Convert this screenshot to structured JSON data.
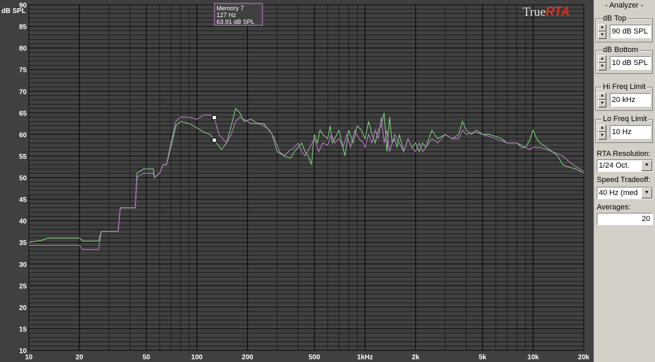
{
  "plot": {
    "y_unit_label": "dB SPL",
    "brand_true": "True",
    "brand_rta": "RTA",
    "cursor": {
      "name": "Memory 7",
      "freq": "127 Hz",
      "level": "63.91 dB SPL"
    },
    "colors": {
      "background": "#404040",
      "grid": "#0d0d0d",
      "series_green": "#7dde7d",
      "series_magenta": "#c77fd6"
    }
  },
  "panel": {
    "title": "- Analyzer -",
    "db_top": {
      "label": "dB Top",
      "value": "90 dB SPL"
    },
    "db_bottom": {
      "label": "dB Bottom",
      "value": "10 dB SPL"
    },
    "hi_freq": {
      "label": "Hi Freq Limit",
      "value": "20 kHz"
    },
    "lo_freq": {
      "label": "Lo Freq Limit",
      "value": "10 Hz"
    },
    "rta_resolution": {
      "label": "RTA Resolution:",
      "value": "1/24 Oct."
    },
    "speed_tradeoff": {
      "label": "Speed Tradeoff:",
      "value": "40 Hz (med"
    },
    "averages": {
      "label": "Averages:",
      "value": "20"
    }
  },
  "chart_data": {
    "type": "line",
    "xscale": "log",
    "xlim": [
      10,
      20000
    ],
    "ylim": [
      10,
      90
    ],
    "ylabel": "dB SPL",
    "xticks": [
      {
        "v": 10,
        "t": "10"
      },
      {
        "v": 20,
        "t": "20"
      },
      {
        "v": 50,
        "t": "50"
      },
      {
        "v": 100,
        "t": "100"
      },
      {
        "v": 200,
        "t": "200"
      },
      {
        "v": 500,
        "t": "500"
      },
      {
        "v": 1000,
        "t": "1kHz"
      },
      {
        "v": 2000,
        "t": "2k"
      },
      {
        "v": 5000,
        "t": "5k"
      },
      {
        "v": 10000,
        "t": "10k"
      },
      {
        "v": 20000,
        "t": "20k"
      }
    ],
    "yticks": [
      10,
      15,
      20,
      25,
      30,
      35,
      40,
      45,
      50,
      55,
      60,
      65,
      70,
      75,
      80,
      85,
      90
    ],
    "series": [
      {
        "color": "#7dde7d",
        "points": [
          [
            10,
            35
          ],
          [
            12,
            35.5
          ],
          [
            13,
            36
          ],
          [
            20,
            36
          ],
          [
            21,
            35.3
          ],
          [
            26,
            35.3
          ],
          [
            27,
            37.5
          ],
          [
            34,
            37.5
          ],
          [
            35,
            43
          ],
          [
            43,
            43
          ],
          [
            44,
            51
          ],
          [
            48,
            52
          ],
          [
            55,
            52
          ],
          [
            56,
            50
          ],
          [
            60,
            51
          ],
          [
            63,
            53
          ],
          [
            66,
            53
          ],
          [
            70,
            57
          ],
          [
            75,
            62
          ],
          [
            80,
            63
          ],
          [
            90,
            62.5
          ],
          [
            100,
            61.5
          ],
          [
            110,
            60.5
          ],
          [
            120,
            60
          ],
          [
            125,
            59
          ],
          [
            140,
            56.5
          ],
          [
            150,
            58
          ],
          [
            160,
            62
          ],
          [
            170,
            66
          ],
          [
            180,
            65
          ],
          [
            190,
            63
          ],
          [
            210,
            63.5
          ],
          [
            230,
            62.5
          ],
          [
            250,
            62.5
          ],
          [
            280,
            60
          ],
          [
            300,
            56
          ],
          [
            330,
            55
          ],
          [
            360,
            54.5
          ],
          [
            380,
            56
          ],
          [
            400,
            57
          ],
          [
            420,
            58
          ],
          [
            440,
            56
          ],
          [
            460,
            55
          ],
          [
            480,
            53
          ],
          [
            500,
            60
          ],
          [
            520,
            58
          ],
          [
            540,
            61
          ],
          [
            560,
            60
          ],
          [
            600,
            59
          ],
          [
            620,
            62
          ],
          [
            640,
            58
          ],
          [
            680,
            60
          ],
          [
            700,
            61
          ],
          [
            730,
            58
          ],
          [
            760,
            55
          ],
          [
            800,
            61
          ],
          [
            850,
            58
          ],
          [
            900,
            62
          ],
          [
            950,
            61
          ],
          [
            1000,
            59
          ],
          [
            1050,
            63
          ],
          [
            1100,
            60
          ],
          [
            1150,
            58
          ],
          [
            1200,
            61
          ],
          [
            1250,
            62
          ],
          [
            1300,
            65
          ],
          [
            1350,
            56
          ],
          [
            1400,
            64
          ],
          [
            1450,
            58
          ],
          [
            1500,
            59
          ],
          [
            1550,
            57
          ],
          [
            1600,
            60
          ],
          [
            1700,
            56
          ],
          [
            1800,
            59
          ],
          [
            1900,
            57
          ],
          [
            2000,
            58
          ],
          [
            2100,
            56
          ],
          [
            2200,
            58
          ],
          [
            2300,
            57
          ],
          [
            2500,
            61
          ],
          [
            2700,
            59
          ],
          [
            3000,
            60
          ],
          [
            3300,
            59
          ],
          [
            3600,
            60
          ],
          [
            3800,
            63
          ],
          [
            4000,
            61
          ],
          [
            4300,
            60
          ],
          [
            4600,
            61
          ],
          [
            5000,
            60
          ],
          [
            5500,
            60
          ],
          [
            6000,
            59.5
          ],
          [
            6500,
            59
          ],
          [
            7000,
            58
          ],
          [
            7500,
            58
          ],
          [
            8000,
            58
          ],
          [
            8500,
            57.5
          ],
          [
            9000,
            57
          ],
          [
            9500,
            58.5
          ],
          [
            10000,
            61
          ],
          [
            10500,
            59
          ],
          [
            11000,
            58
          ],
          [
            12000,
            57
          ],
          [
            13000,
            56
          ],
          [
            14000,
            55
          ],
          [
            15000,
            53
          ],
          [
            16000,
            52.5
          ],
          [
            18000,
            52
          ],
          [
            20000,
            51
          ]
        ]
      },
      {
        "color": "#c77fd6",
        "points": [
          [
            10,
            34.3
          ],
          [
            20,
            34.3
          ],
          [
            21,
            33.3
          ],
          [
            26,
            33.3
          ],
          [
            27,
            37.5
          ],
          [
            34,
            37.5
          ],
          [
            35,
            43
          ],
          [
            43,
            43
          ],
          [
            44,
            50
          ],
          [
            48,
            51
          ],
          [
            55,
            51
          ],
          [
            56,
            50
          ],
          [
            60,
            51
          ],
          [
            63,
            53
          ],
          [
            66,
            53
          ],
          [
            70,
            58
          ],
          [
            75,
            63
          ],
          [
            80,
            64
          ],
          [
            90,
            64
          ],
          [
            100,
            63.5
          ],
          [
            110,
            64.5
          ],
          [
            120,
            64.5
          ],
          [
            127,
            63.9
          ],
          [
            135,
            60
          ],
          [
            150,
            58
          ],
          [
            160,
            60
          ],
          [
            170,
            63
          ],
          [
            180,
            64
          ],
          [
            190,
            63.5
          ],
          [
            210,
            62.5
          ],
          [
            230,
            62.5
          ],
          [
            250,
            62
          ],
          [
            270,
            61
          ],
          [
            290,
            59
          ],
          [
            310,
            56
          ],
          [
            330,
            55
          ],
          [
            350,
            56
          ],
          [
            380,
            57
          ],
          [
            400,
            58
          ],
          [
            420,
            56
          ],
          [
            440,
            55
          ],
          [
            470,
            57
          ],
          [
            500,
            59
          ],
          [
            530,
            56
          ],
          [
            560,
            58
          ],
          [
            600,
            57.5
          ],
          [
            630,
            60
          ],
          [
            660,
            58
          ],
          [
            700,
            59
          ],
          [
            740,
            57
          ],
          [
            780,
            60
          ],
          [
            820,
            57
          ],
          [
            870,
            61
          ],
          [
            920,
            59
          ],
          [
            980,
            58
          ],
          [
            1000,
            57
          ],
          [
            1050,
            60
          ],
          [
            1100,
            58
          ],
          [
            1150,
            61
          ],
          [
            1200,
            59
          ],
          [
            1250,
            64
          ],
          [
            1300,
            58
          ],
          [
            1350,
            61
          ],
          [
            1400,
            56
          ],
          [
            1500,
            60
          ],
          [
            1600,
            58
          ],
          [
            1700,
            56
          ],
          [
            1800,
            59
          ],
          [
            1900,
            57
          ],
          [
            2000,
            56
          ],
          [
            2100,
            58
          ],
          [
            2200,
            56
          ],
          [
            2300,
            57
          ],
          [
            2500,
            59
          ],
          [
            2700,
            58
          ],
          [
            3000,
            60
          ],
          [
            3300,
            59
          ],
          [
            3600,
            59
          ],
          [
            3800,
            61
          ],
          [
            4000,
            60
          ],
          [
            4500,
            60.5
          ],
          [
            5000,
            60
          ],
          [
            5500,
            59.5
          ],
          [
            6000,
            59
          ],
          [
            6500,
            58.5
          ],
          [
            7000,
            58
          ],
          [
            7500,
            58
          ],
          [
            8000,
            58
          ],
          [
            8500,
            57
          ],
          [
            9000,
            57
          ],
          [
            9500,
            56.5
          ],
          [
            10000,
            57
          ],
          [
            11000,
            57
          ],
          [
            12000,
            56.5
          ],
          [
            13000,
            56
          ],
          [
            14000,
            55.5
          ],
          [
            15000,
            55
          ],
          [
            16000,
            54
          ],
          [
            18000,
            52.5
          ],
          [
            20000,
            51.5
          ]
        ]
      }
    ]
  }
}
